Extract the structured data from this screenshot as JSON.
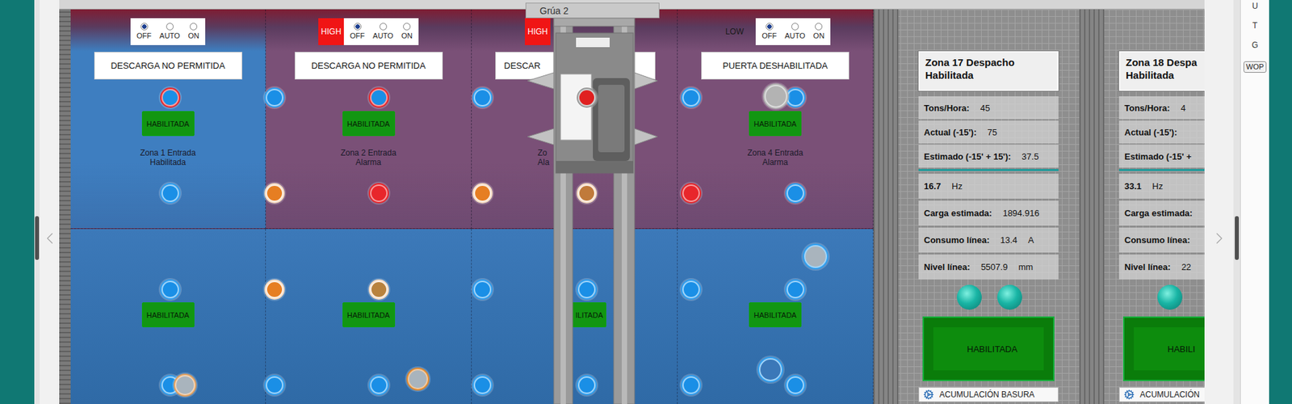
{
  "crane": {
    "title": "Grúa 2"
  },
  "pit": {
    "top_zones": [
      {
        "modes": [
          {
            "label": "OFF",
            "selected": true
          },
          {
            "label": "AUTO",
            "selected": false
          },
          {
            "label": "ON",
            "selected": false
          }
        ],
        "banner": "DESCARGA NO PERMITIDA",
        "button": "HABILITADA",
        "label": [
          "Zona 1 Entrada",
          "Habilitada"
        ],
        "color": "#3e7ec0"
      },
      {
        "badge": {
          "label": "HIGH",
          "active": true
        },
        "modes": [
          {
            "label": "OFF",
            "selected": true
          },
          {
            "label": "AUTO",
            "selected": false
          },
          {
            "label": "ON",
            "selected": false
          }
        ],
        "banner": "DESCARGA NO PERMITIDA",
        "button": "HABILITADA",
        "label": [
          "Zona 2 Entrada",
          "Alarma"
        ],
        "color": "#7a5077"
      },
      {
        "badge": {
          "label": "HIGH",
          "active": true
        },
        "banner": "DESCAR",
        "label": [
          "Zo",
          "Ala"
        ],
        "color": "#7a5077"
      },
      {
        "badge": {
          "label": "LOW",
          "active": false
        },
        "modes": [
          {
            "label": "OFF",
            "selected": true
          },
          {
            "label": "AUTO",
            "selected": false
          },
          {
            "label": "ON",
            "selected": false
          }
        ],
        "banner": "PUERTA DESHABILITADA",
        "button": "HABILITADA",
        "label": [
          "Zona 4 Entrada",
          "Alarma"
        ],
        "color": "#7a5077"
      }
    ],
    "bottom_zones": [
      {
        "button": "HABILITADA",
        "color": "#3c79b9"
      },
      {
        "button": "HABILITADA",
        "color": "#3c79b9"
      },
      {
        "button": "ILITADA",
        "color": "#3c79b9"
      },
      {
        "button": "HABILITADA",
        "color": "#3c79b9"
      }
    ],
    "sensors": [
      [
        {
          "fill": "#1a8fe6",
          "ring": "#e8262b"
        },
        {
          "fill": "#1a8fe6",
          "ring": "#2f9ff0"
        },
        {
          "fill": "#1a8fe6",
          "ring": "#e8262b"
        },
        {
          "fill": "#1a8fe6",
          "ring": "#2f9ff0"
        },
        {
          "fill": "#e02020",
          "ring": "#9a9a9a"
        },
        {
          "fill": "#1a8fe6",
          "ring": "#2f9ff0"
        },
        {
          "fill": "#1a8fe6",
          "ring": "#2f9ff0"
        }
      ],
      [
        {
          "fill": "#1a8fe6",
          "ring": "#2f9ff0"
        },
        {
          "fill": "#e67e22",
          "ring": "#f5dcc4"
        },
        {
          "fill": "#e8262b",
          "ring": "#e8262b"
        },
        {
          "fill": "#e67e22",
          "ring": "#f5dcc4"
        },
        {
          "fill": "#c07a3a",
          "ring": "#f5dcc4"
        },
        {
          "fill": "#e8262b",
          "ring": "#e8262b"
        },
        {
          "fill": "#1a8fe6",
          "ring": "#2f9ff0"
        }
      ],
      [
        {
          "fill": "#1a8fe6",
          "ring": "#2f9ff0"
        },
        {
          "fill": "#e67e22",
          "ring": "#f5dcc4"
        },
        {
          "fill": "#b8823e",
          "ring": "#f5dcc4"
        },
        {
          "fill": "#1a8fe6",
          "ring": "#2f9ff0"
        },
        {
          "fill": "#1a8fe6",
          "ring": "#2f9ff0"
        },
        {
          "fill": "#1a8fe6",
          "ring": "#2f9ff0"
        },
        {
          "fill": "#1a8fe6",
          "ring": "#2f9ff0"
        }
      ],
      [
        {
          "fill": "#1a8fe6",
          "ring": "#2f9ff0"
        },
        {
          "fill": "#1a8fe6",
          "ring": "#2f9ff0"
        },
        {
          "fill": "#1a8fe6",
          "ring": "#2f9ff0"
        },
        {
          "fill": "#1a8fe6",
          "ring": "#2f9ff0"
        },
        {
          "fill": "#1a8fe6",
          "ring": "#2f9ff0"
        },
        {
          "fill": "#1a8fe6",
          "ring": "#2f9ff0"
        },
        {
          "fill": "#1a8fe6",
          "ring": "#2f9ff0"
        }
      ]
    ],
    "extra_sensors": [
      {
        "fill": "#b3b3b3",
        "ring": "#b3b3b3"
      },
      {
        "fill": "#a9b4bd",
        "ring": "#2f9ff0"
      },
      {
        "fill": "#3b78b8",
        "ring": "#2f9ff0"
      },
      {
        "fill": "#a9b4bd",
        "ring": "#e0a060"
      },
      {
        "fill": "#a9b4bd",
        "ring": "#e08a30"
      }
    ]
  },
  "dispatch_zones": [
    {
      "header": [
        "Zona 17 Despacho",
        "Habilitada"
      ],
      "upper_rows": [
        {
          "label": "Tons/Hora:",
          "value": "45"
        },
        {
          "label": "Actual (-15'):",
          "value": "75"
        },
        {
          "label": "Estimado (-15' + 15'):",
          "value": "37.5"
        }
      ],
      "lower_rows": [
        {
          "label": "16.7",
          "unit": "Hz"
        },
        {
          "label": "Carga estimada:",
          "value": "1894.916"
        },
        {
          "label": "Consumo línea:",
          "value": "13.4",
          "unit": "A"
        },
        {
          "label": "Nivel línea:",
          "value": "5507.9",
          "unit": "mm"
        }
      ],
      "lights": [
        {
          "color": "#19b5a5"
        },
        {
          "color": "#19b5a5"
        }
      ],
      "button": "HABILITADA",
      "footer": "ACUMULACIÓN BASURA"
    },
    {
      "header": [
        "Zona 18 Despa",
        "Habilitada"
      ],
      "upper_rows": [
        {
          "label": "Tons/Hora:",
          "value": "4"
        },
        {
          "label": "Actual (-15'):"
        },
        {
          "label": "Estimado (-15' +"
        }
      ],
      "lower_rows": [
        {
          "label": "33.1",
          "unit": "Hz"
        },
        {
          "label": "Carga estimada:"
        },
        {
          "label": "Consumo línea:"
        },
        {
          "label": "Nivel línea:",
          "value": "22"
        }
      ],
      "lights": [
        {
          "color": "#19b5a5"
        }
      ],
      "button": "HABILI",
      "footer": "ACUMULACIÓN"
    }
  ],
  "side_buttons": [
    {
      "label": "U",
      "kind": "letter"
    },
    {
      "label": "T",
      "kind": "letter"
    },
    {
      "label": "G",
      "kind": "letter"
    },
    {
      "label": "WOP",
      "kind": "button"
    }
  ]
}
